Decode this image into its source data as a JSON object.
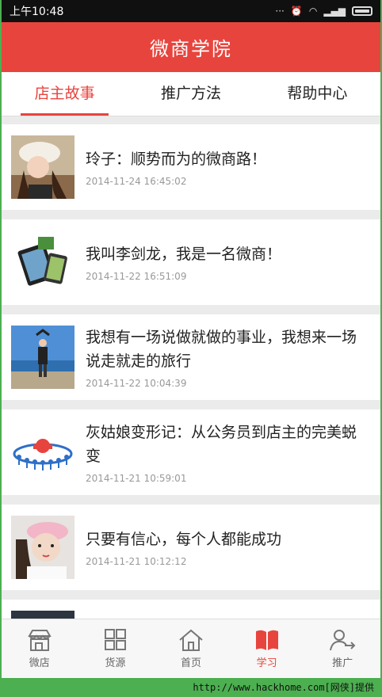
{
  "status_bar": {
    "time": "上午10:48"
  },
  "header": {
    "title": "微商学院"
  },
  "tabs": [
    {
      "label": "店主故事",
      "active": true
    },
    {
      "label": "推广方法",
      "active": false
    },
    {
      "label": "帮助中心",
      "active": false
    }
  ],
  "articles": [
    {
      "title": "玲子：顺势而为的微商路！",
      "date": "2014-11-24 16:45:02"
    },
    {
      "title": "我叫李剑龙，我是一名微商！",
      "date": "2014-11-22 16:51:09"
    },
    {
      "title": "我想有一场说做就做的事业，我想来一场说走就走的旅行",
      "date": "2014-11-22 10:04:39"
    },
    {
      "title": "灰姑娘变形记：从公务员到店主的完美蜕变",
      "date": "2014-11-21 10:59:01"
    },
    {
      "title": "只要有信心，每个人都能成功",
      "date": "2014-11-21 10:12:12"
    }
  ],
  "bottom_nav": [
    {
      "label": "微店",
      "icon": "shop-icon",
      "active": false
    },
    {
      "label": "货源",
      "icon": "grid-icon",
      "active": false
    },
    {
      "label": "首页",
      "icon": "home-icon",
      "active": false
    },
    {
      "label": "学习",
      "icon": "book-icon",
      "active": true
    },
    {
      "label": "推广",
      "icon": "user-share-icon",
      "active": false
    }
  ],
  "watermark": "http://www.hackhome.com[网侠]提供",
  "colors": {
    "brand": "#e8443e",
    "nav_inactive": "#666666"
  }
}
